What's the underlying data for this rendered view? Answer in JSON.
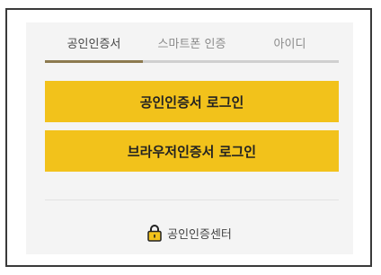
{
  "tabs": [
    {
      "label": "공인인증서",
      "active": true
    },
    {
      "label": "스마트폰 인증",
      "active": false
    },
    {
      "label": "아이디",
      "active": false
    }
  ],
  "buttons": {
    "cert_login": "공인인증서 로그인",
    "browser_cert_login": "브라우저인증서 로그인"
  },
  "footer": {
    "cert_center_label": "공인인증센터",
    "icon": "lock-icon"
  },
  "colors": {
    "button_bg": "#f2c21b",
    "tab_active_underline": "#8c7a4f",
    "panel_bg": "#f4f4f4"
  }
}
